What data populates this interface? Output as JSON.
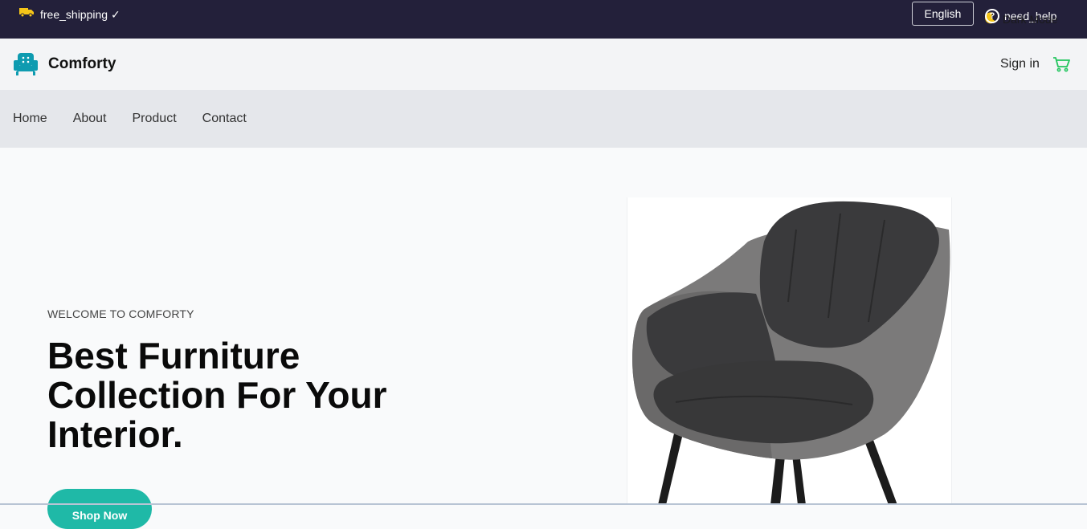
{
  "topbar": {
    "shipping_label": "free_shipping ✓",
    "language": "English",
    "help_label": "need_help",
    "dark_mode_label": "Dark Mode"
  },
  "header": {
    "brand": "Comforty",
    "sign_in": "Sign in"
  },
  "nav": {
    "items": [
      "Home",
      "About",
      "Product",
      "Contact"
    ]
  },
  "hero": {
    "eyebrow": "WELCOME TO COMFORTY",
    "title": "Best Furniture Collection For Your Interior.",
    "cta": "Shop Now"
  },
  "icons": {
    "truck": "truck-icon",
    "help": "help-icon",
    "moon": "moon-icon",
    "logo": "armchair-logo-icon",
    "cart": "cart-icon"
  },
  "colors": {
    "topbar_bg": "#23203a",
    "accent": "#1fb9a7",
    "logo": "#0e9bb0",
    "cart": "#22c55e",
    "truck": "#f5c518"
  }
}
